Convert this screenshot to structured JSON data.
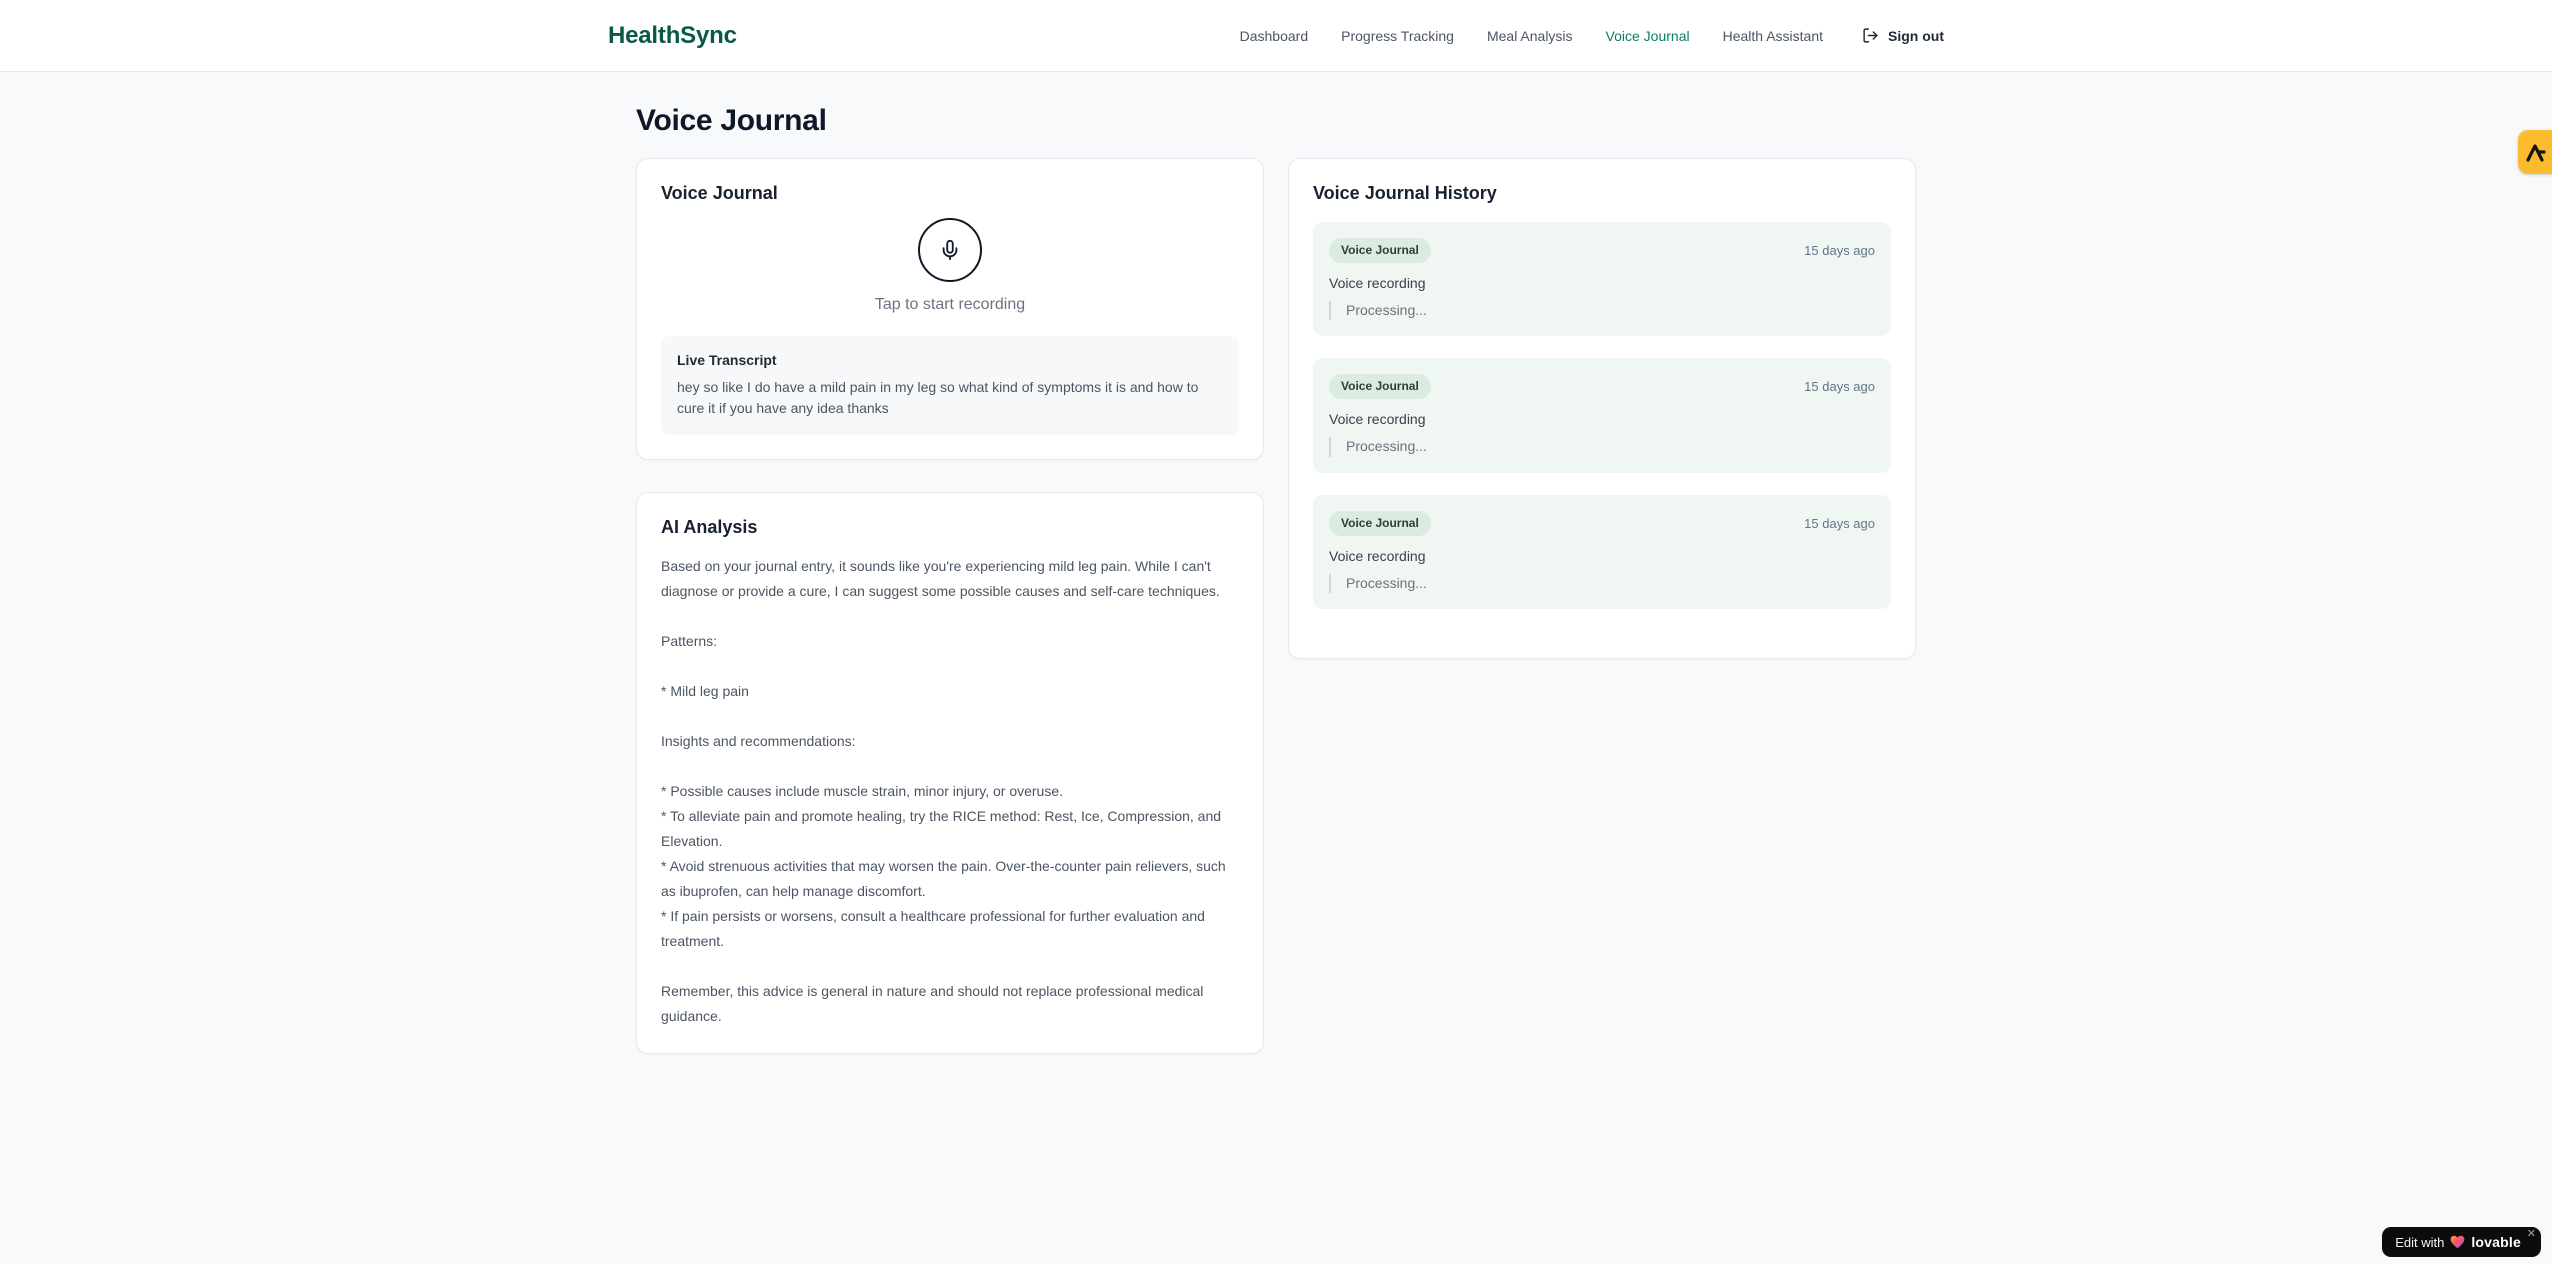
{
  "brand": {
    "name": "HealthSync"
  },
  "nav": {
    "items": [
      {
        "label": "Dashboard",
        "active": false
      },
      {
        "label": "Progress Tracking",
        "active": false
      },
      {
        "label": "Meal Analysis",
        "active": false
      },
      {
        "label": "Voice Journal",
        "active": true
      },
      {
        "label": "Health Assistant",
        "active": false
      }
    ],
    "sign_out_label": "Sign out"
  },
  "page": {
    "title": "Voice Journal"
  },
  "recorder_card": {
    "title": "Voice Journal",
    "tap_hint": "Tap to start recording",
    "transcript_label": "Live Transcript",
    "transcript_text": "hey so like I do have a mild pain in my leg so what kind of symptoms it is and how to cure it if you have any idea thanks"
  },
  "analysis_card": {
    "title": "AI Analysis",
    "body": "Based on your journal entry, it sounds like you're experiencing mild leg pain. While I can't diagnose or provide a cure, I can suggest some possible causes and self-care techniques.\n\nPatterns:\n\n* Mild leg pain\n\nInsights and recommendations:\n\n* Possible causes include muscle strain, minor injury, or overuse.\n* To alleviate pain and promote healing, try the RICE method: Rest, Ice, Compression, and Elevation.\n* Avoid strenuous activities that may worsen the pain. Over-the-counter pain relievers, such as ibuprofen, can help manage discomfort.\n* If pain persists or worsens, consult a healthcare professional for further evaluation and treatment.\n\nRemember, this advice is general in nature and should not replace professional medical guidance."
  },
  "history_card": {
    "title": "Voice Journal History",
    "entries": [
      {
        "badge": "Voice Journal",
        "time": "15 days ago",
        "title": "Voice recording",
        "status": "Processing..."
      },
      {
        "badge": "Voice Journal",
        "time": "15 days ago",
        "title": "Voice recording",
        "status": "Processing..."
      },
      {
        "badge": "Voice Journal",
        "time": "15 days ago",
        "title": "Voice recording",
        "status": "Processing..."
      }
    ]
  },
  "widgets": {
    "edit_pill_text": "Edit with",
    "edit_pill_brand": "lovable",
    "close_glyph": "✕"
  },
  "colors": {
    "brand_green": "#0a5948",
    "nav_active_green": "#0e7a64",
    "badge_bg": "#dcebe1",
    "entry_bg": "#f0f6f1",
    "side_badge_yellow": "#fcbb2d",
    "pill_bg": "#0c0c0d",
    "page_bg": "#f8f9fb"
  }
}
